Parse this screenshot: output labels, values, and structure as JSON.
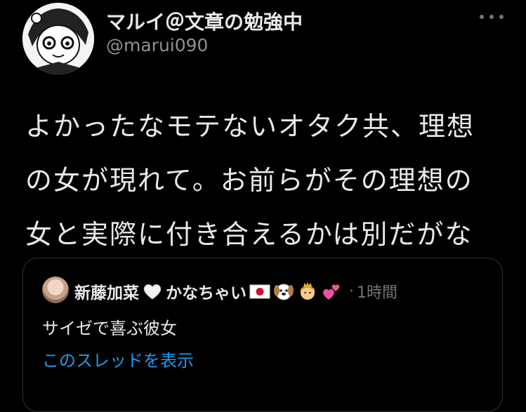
{
  "author": {
    "display_name": "マルイ＠文章の勉強中",
    "handle": "@marui090"
  },
  "tweet": {
    "lines": [
      "よかったなモテないオタク共、理想",
      "の女が現れて。お前らがその理想の",
      "女と実際に付き合えるかは別だがな"
    ]
  },
  "quoted_tweet": {
    "author_name": "新藤加菜",
    "author_name_suffix": "かなちゃい",
    "separator": "·",
    "time": "1時間",
    "text": "サイゼで喜ぶ彼女",
    "thread_link": "このスレッドを表示"
  },
  "icons": {
    "more": "more-horizontal-icon",
    "name_emojis": [
      "white-heart-icon",
      "japan-flag-icon",
      "dog-face-icon",
      "princess-icon",
      "two-hearts-icon"
    ]
  },
  "colors": {
    "background": "#000000",
    "text": "#e7e9ea",
    "secondary": "#71767b",
    "link": "#1d9bf0",
    "border": "#2f3336"
  }
}
